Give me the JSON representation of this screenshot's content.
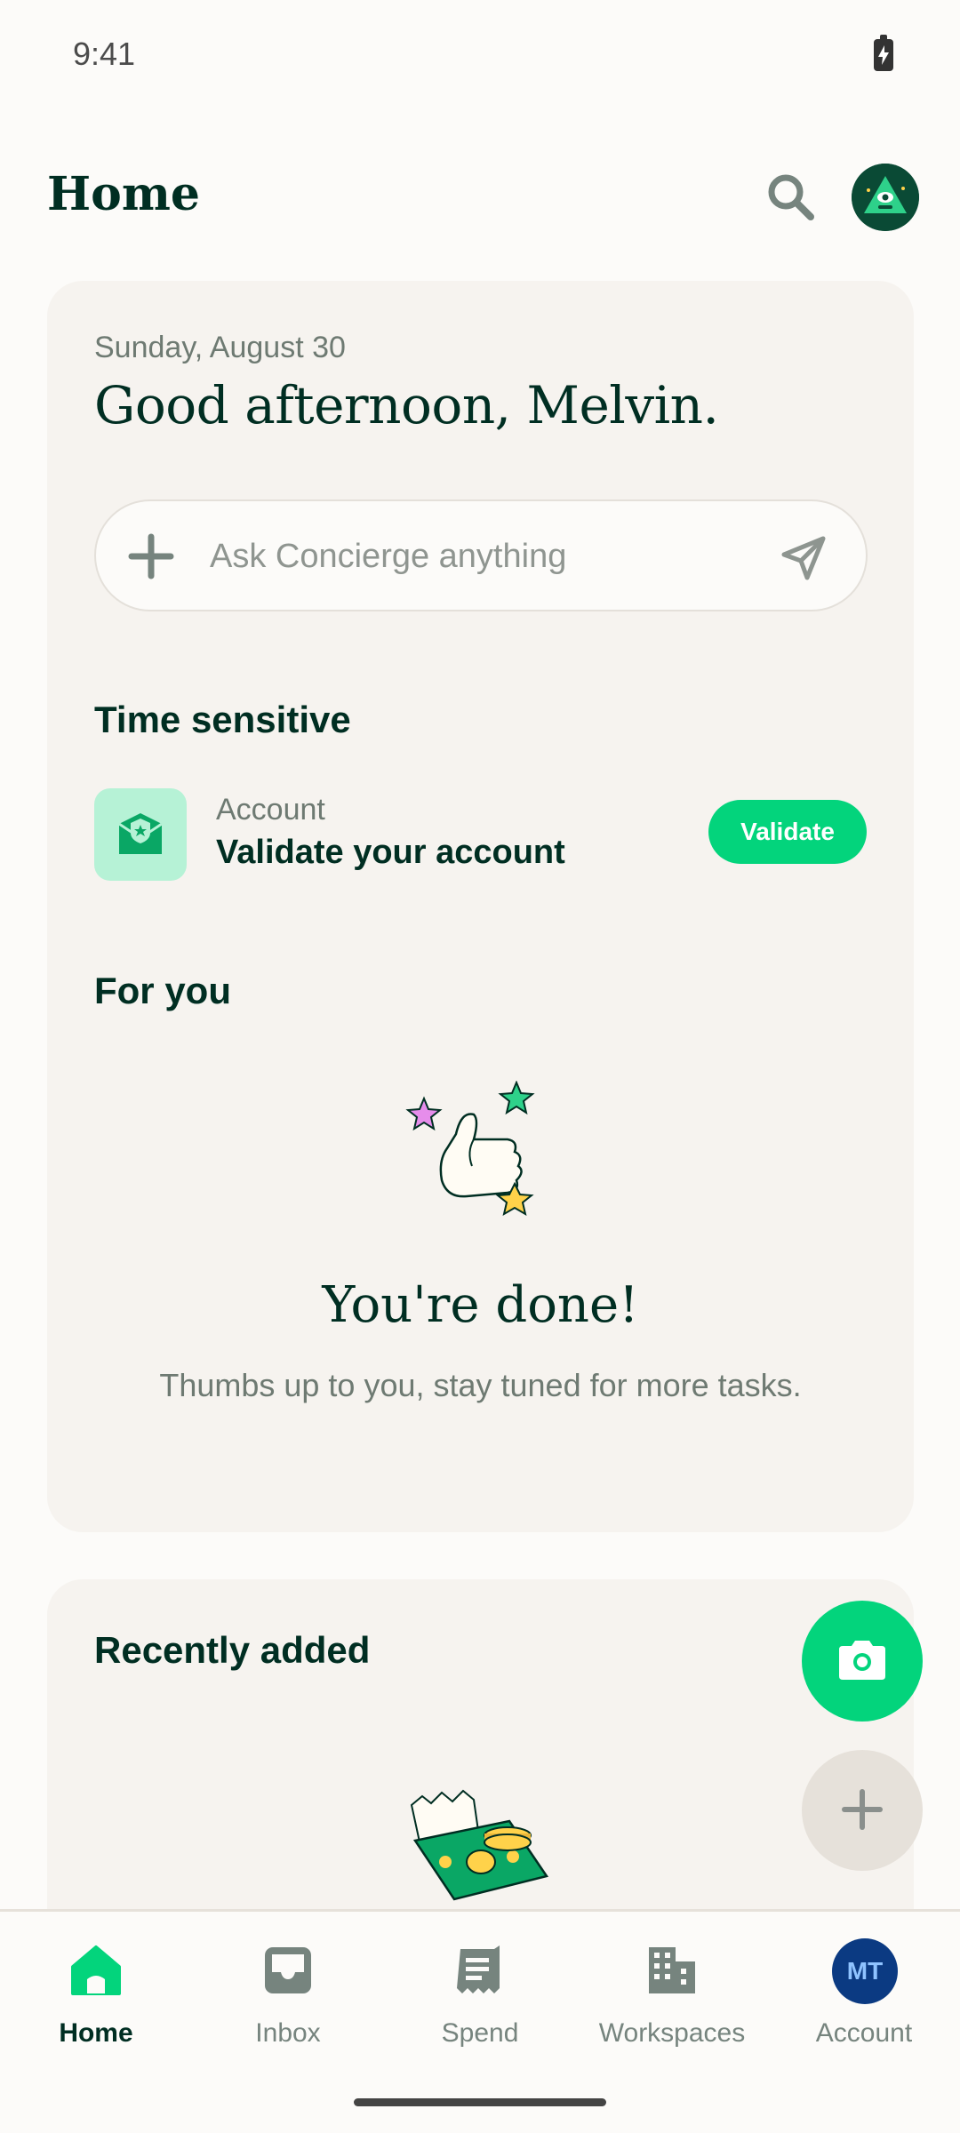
{
  "status_bar": {
    "time": "9:41",
    "battery_icon": "battery-charging-icon"
  },
  "header": {
    "title": "Home",
    "search_icon": "search-icon",
    "avatar_icon": "avatar-illustration"
  },
  "greeting_card": {
    "date": "Sunday, August 30",
    "greeting": "Good afternoon, Melvin.",
    "ask_bar": {
      "placeholder": "Ask Concierge anything",
      "value": "",
      "add_icon": "plus-icon",
      "send_icon": "paper-plane-icon"
    },
    "time_sensitive": {
      "title": "Time sensitive",
      "item": {
        "icon": "shield-envelope-icon",
        "category": "Account",
        "title": "Validate your account",
        "action_label": "Validate"
      }
    },
    "for_you": {
      "title": "For you",
      "illustration": "thumbs-up-stars-illustration",
      "empty_title": "You're done!",
      "empty_subtitle": "Thumbs up to you, stay tuned for more tasks."
    }
  },
  "recently_added": {
    "title": "Recently added",
    "illustration": "cash-receipt-illustration"
  },
  "fabs": {
    "camera_icon": "camera-icon",
    "add_icon": "plus-icon"
  },
  "bottom_nav": {
    "items": [
      {
        "label": "Home",
        "icon": "home-icon",
        "active": true
      },
      {
        "label": "Inbox",
        "icon": "inbox-icon",
        "active": false
      },
      {
        "label": "Spend",
        "icon": "receipt-icon",
        "active": false
      },
      {
        "label": "Workspaces",
        "icon": "building-icon",
        "active": false
      },
      {
        "label": "Account",
        "icon": "account-avatar",
        "active": false,
        "initials": "MT"
      }
    ]
  },
  "colors": {
    "accent": "#03D47C",
    "text_dark": "#002E22",
    "text_muted": "#6E7A72",
    "card_bg": "#F6F3EF",
    "page_bg": "#FCFBF9",
    "account_avatar": "#0B3A82"
  }
}
